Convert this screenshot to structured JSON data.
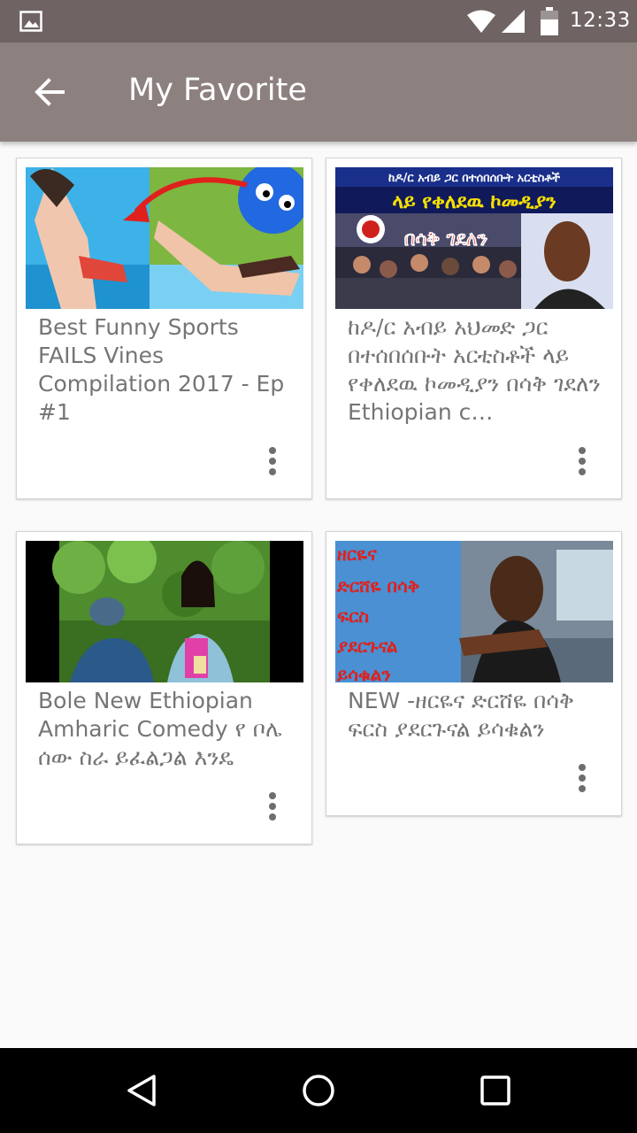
{
  "status_bar": {
    "time": "12:33",
    "icons": [
      "image-notification-icon",
      "wifi-icon",
      "signal-icon",
      "battery-icon"
    ]
  },
  "app_bar": {
    "title": "My Favorite",
    "back_icon": "arrow-left-icon"
  },
  "videos": [
    {
      "title": "Best Funny Sports FAILS Vines Compilation 2017 - Ep #1",
      "more_icon": "more-vert-icon"
    },
    {
      "title": "ከዶ/ር አብይ አህመድ ጋር በተሰበሰቡት አርቲስቶች ላይ የቀለደዉ ኮመዲያን በሳቅ ገደለን Ethiopian c…",
      "thumbnail_text": [
        "ከዶ/ር አብይ ጋር በተሰበሰቡት አርቲስቶች",
        "ላይ የቀለደዉ ኮመዲያን",
        "በሳቅ ገደለን"
      ],
      "more_icon": "more-vert-icon"
    },
    {
      "title": "Bole New Ethiopian Amharic Comedy የ ቦሌ ሰው ስራ ይፈልጋል እንዴ",
      "more_icon": "more-vert-icon"
    },
    {
      "title": "NEW -ዘርዬና ድርሸዬ በሳቅ ፍርስ ያደርጉናል ይሳቁልን",
      "thumbnail_text": [
        "ዘርዬና",
        "ድርሸዬ በሳቅ",
        "ፍርስ",
        "ያደርጉናል",
        "ይሳቁልን"
      ],
      "more_icon": "more-vert-icon"
    }
  ],
  "nav_bar": {
    "buttons": [
      "back-triangle-icon",
      "home-circle-icon",
      "recents-square-icon"
    ]
  },
  "colors": {
    "status_bar": "#6f6463",
    "app_bar": "#8d8180",
    "background": "#fafafa",
    "card_text": "#757575"
  }
}
